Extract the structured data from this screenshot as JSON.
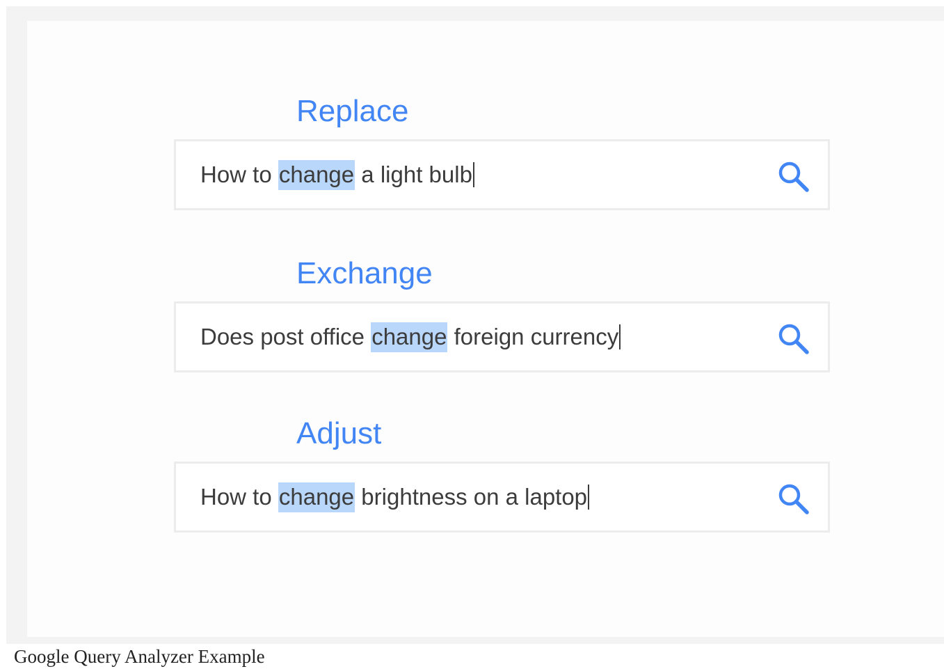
{
  "groups": [
    {
      "title": "Replace",
      "query": {
        "before": "How to ",
        "highlight": "change",
        "after": " a light bulb"
      }
    },
    {
      "title": "Exchange",
      "query": {
        "before": "Does post office ",
        "highlight": "change",
        "after": " foreign currency"
      }
    },
    {
      "title": "Adjust",
      "query": {
        "before": "How to ",
        "highlight": "change",
        "after": " brightness on a laptop"
      }
    }
  ],
  "icons": {
    "search": "search-icon"
  },
  "colors": {
    "accent": "#4285f4",
    "highlight": "#b9d7fb",
    "query_text": "#3c3c3c",
    "box_border": "#ececec"
  },
  "caption": "Google Query Analyzer Example"
}
